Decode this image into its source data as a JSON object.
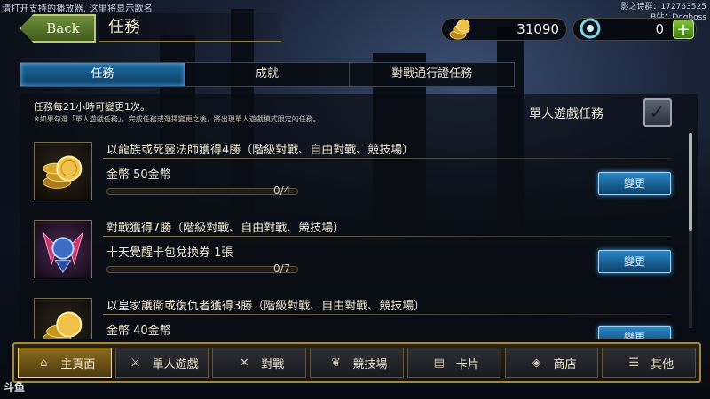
{
  "overlay": {
    "notice": "请打开支持的播放器, 这里将显示歌名",
    "stream_line1": "影之诗群：172763525",
    "stream_line2": "B站：Dogboss",
    "watermark": "斗鱼"
  },
  "header": {
    "back_label": "Back",
    "title": "任務"
  },
  "currency": {
    "gold": "31090",
    "gems": "0",
    "plus": "+"
  },
  "tabs": [
    {
      "label": "任務",
      "active": true
    },
    {
      "label": "成就",
      "active": false
    },
    {
      "label": "對戰通行證任務",
      "active": false
    }
  ],
  "info": {
    "line1": "任務每21小時可變更1次。",
    "line2": "※如果勾選「單人遊戲任務」，完成任務或選擇變更之後，將出現單人遊戲模式限定的任務。",
    "solo_label": "單人遊戲任務",
    "solo_checked": true
  },
  "missions": [
    {
      "description": "以龍族或死靈法師獲得4勝（階級對戰、自由對戰、競技場）",
      "reward": "金幣 50金幣",
      "progress_text": "0/4",
      "progress": 0,
      "icon": "gold-coins-icon",
      "button": "變更"
    },
    {
      "description": "對戰獲得7勝（階級對戰、自由對戰、競技場）",
      "reward": "十天覺醒卡包兌換券 1張",
      "progress_text": "0/7",
      "progress": 0,
      "icon": "card-pack-ticket-icon",
      "button": "變更"
    },
    {
      "description": "以皇家護衛或復仇者獲得3勝（階級對戰、自由對戰、競技場）",
      "reward": "金幣 40金幣",
      "progress_text": "",
      "progress": 0,
      "icon": "gold-coins-icon",
      "button": "變更"
    }
  ],
  "bottom_nav": [
    {
      "label": "主頁面",
      "icon": "home-icon",
      "active": true
    },
    {
      "label": "單人遊戲",
      "icon": "sword-icon",
      "active": false
    },
    {
      "label": "對戰",
      "icon": "crossed-swords-icon",
      "active": false
    },
    {
      "label": "競技場",
      "icon": "laurel-icon",
      "active": false
    },
    {
      "label": "卡片",
      "icon": "cards-icon",
      "active": false
    },
    {
      "label": "商店",
      "icon": "shop-icon",
      "active": false
    },
    {
      "label": "其他",
      "icon": "menu-icon",
      "active": false
    }
  ],
  "colors": {
    "accent_blue": "#1d6b9f",
    "gold_frame": "#a3853f",
    "back_green": "#5a7a2c"
  }
}
